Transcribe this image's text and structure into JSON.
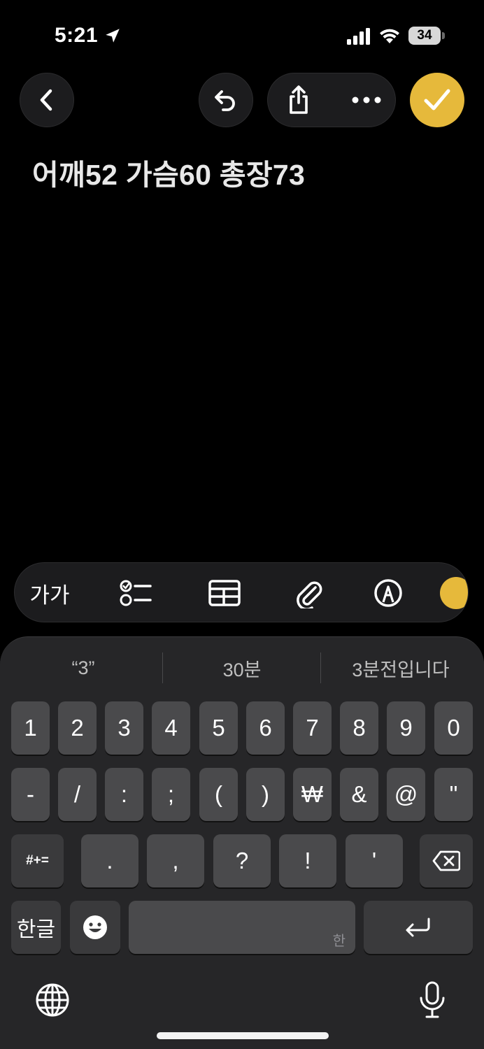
{
  "status_bar": {
    "time": "5:21",
    "battery": "34"
  },
  "note": {
    "text": "어깨52 가슴60 총장73"
  },
  "toolbar": {
    "text_style_label": "가가"
  },
  "suggestions": [
    "“3”",
    "30분",
    "3분전입니다"
  ],
  "keyboard": {
    "row1": [
      "1",
      "2",
      "3",
      "4",
      "5",
      "6",
      "7",
      "8",
      "9",
      "0"
    ],
    "row2": [
      "-",
      "/",
      ":",
      ";",
      "(",
      ")",
      "₩",
      "&",
      "@",
      "\""
    ],
    "row3_symbols_key": "#+=",
    "row3": [
      ".",
      ",",
      "?",
      "!",
      "'"
    ],
    "lang_key": "한글",
    "space_hint": "한"
  },
  "colors": {
    "accent": "#e6b93b",
    "background": "#000000",
    "key": "#4a4a4c"
  }
}
